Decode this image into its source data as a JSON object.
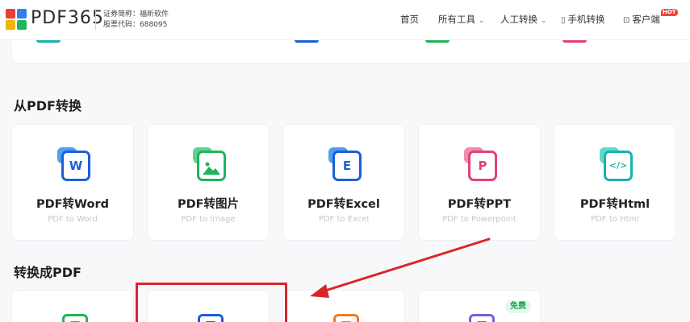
{
  "header": {
    "logo_icon": "pdf365-logo-icon",
    "brand": "PDF365",
    "stock_name_label": "证券简称：",
    "stock_name": "福昕软件",
    "stock_code_label": "股票代码：",
    "stock_code": "688095",
    "nav": {
      "home": "首页",
      "all_tools": "所有工具",
      "manual_convert": "人工转换",
      "mobile_convert": "手机转换",
      "client": "客户端",
      "hot_badge": "HOT"
    }
  },
  "sections": {
    "from_pdf": {
      "title": "从PDF转换",
      "cards": [
        {
          "title": "PDF转Word",
          "subtitle": "PDF to Word",
          "icon": "word-doc-icon",
          "glyph": "W",
          "color": "#1c5fd9",
          "back_color": "#4ea0f0"
        },
        {
          "title": "PDF转图片",
          "subtitle": "PDF to Image",
          "icon": "image-doc-icon",
          "glyph": "",
          "color": "#21b35c",
          "back_color": "#5dd48d"
        },
        {
          "title": "PDF转Excel",
          "subtitle": "PDF to Excel",
          "icon": "excel-doc-icon",
          "glyph": "E",
          "color": "#1c5fd9",
          "back_color": "#4ea0f0"
        },
        {
          "title": "PDF转PPT",
          "subtitle": "PDF to Powerpoint",
          "icon": "ppt-doc-icon",
          "glyph": "P",
          "color": "#e2407d",
          "back_color": "#f28bb0"
        },
        {
          "title": "PDF转Html",
          "subtitle": "PDF to Html",
          "icon": "html-doc-icon",
          "glyph": "</>",
          "color": "#1ab3aa",
          "back_color": "#5fd8cf"
        }
      ]
    },
    "to_pdf": {
      "title": "转换成PDF",
      "free_badge": "免费"
    }
  },
  "colors": {
    "annotation_red": "#d9252a",
    "page_bg": "#f7f8fa"
  }
}
